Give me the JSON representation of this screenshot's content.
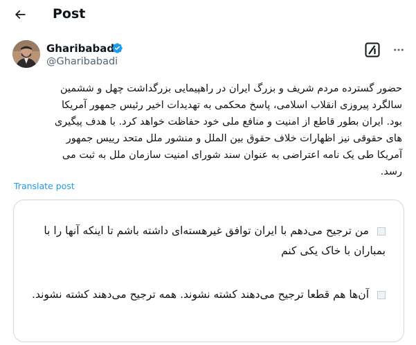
{
  "header": {
    "title": "Post",
    "back_icon": "arrow-left-icon"
  },
  "author": {
    "name": "Gharibabadi",
    "handle": "@Gharibabadi",
    "verified_color": "#1d9bf0"
  },
  "actions": {
    "grok_icon": "grok-icon",
    "more_icon": "more-horizontal-icon"
  },
  "post": {
    "text": "حضور گسترده مردم شریف و بزرگ ایران در راهپیمایی بزرگداشت چهل و ششمین\nسالگرد پیروزی انقلاب اسلامی، پاسخ محکمی به تهدیدات اخیر رئیس جمهور آمریکا\nبود. ایران بطور قاطع از امنیت و منافع ملی خود حفاظت خواهد کرد. با هدف پیگیری\nهای حقوقی نیز اظهارات خلاف حقوق بین الملل و منشور ملل متحد رییس جمهور\nآمریکا طی یک نامه اعتراضی به عنوان سند شورای امنیت سازمان ملل به ثبت می\nرسد.",
    "translate_label": "Translate post"
  },
  "poll": {
    "options": [
      "من ترجیح می‌دهم با ایران توافق غیرهسته‌ای داشته باشم تا اینکه آنها را با بمباران با خاک یکی کنم",
      "آن‌ها هم قطعا ترجیح می‌دهند کشته نشوند. همه ترجیح می‌دهند کشته نشوند."
    ]
  },
  "colors": {
    "link": "#1d9bf0",
    "secondary_text": "#536471",
    "border": "#cfd9de"
  }
}
